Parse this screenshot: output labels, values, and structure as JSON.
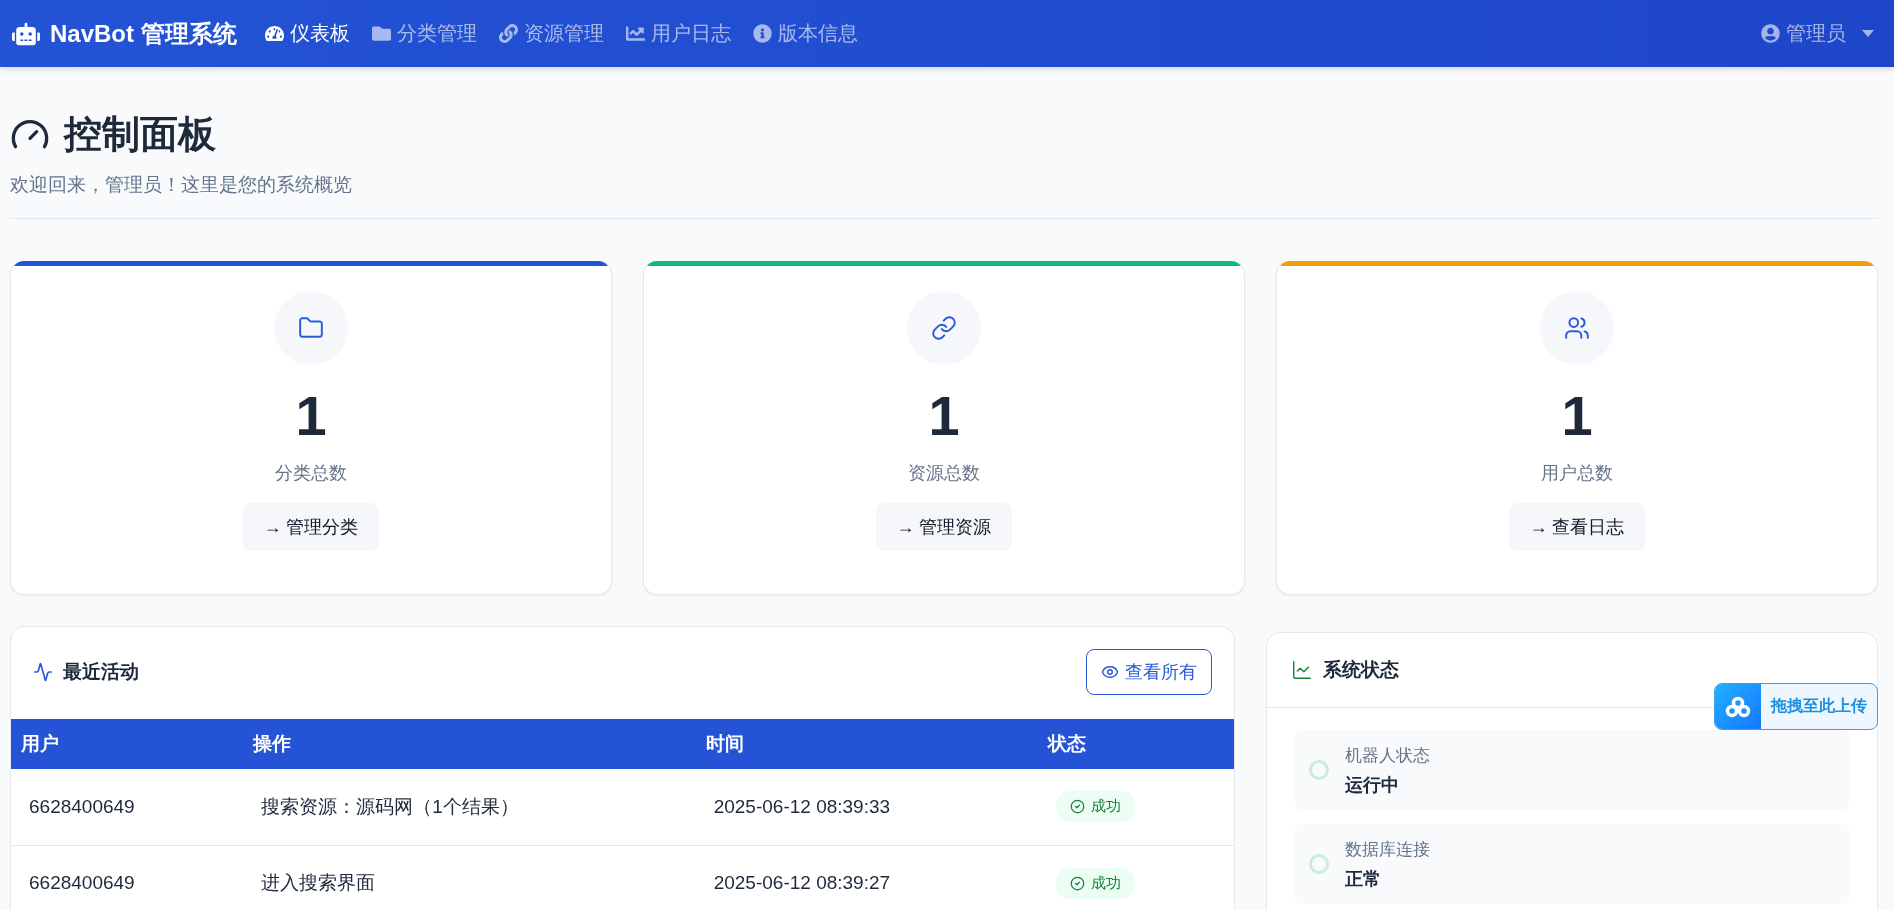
{
  "navbar": {
    "brand": "NavBot 管理系统",
    "items": [
      {
        "label": "仪表板",
        "selected": true
      },
      {
        "label": "分类管理",
        "selected": false
      },
      {
        "label": "资源管理",
        "selected": false
      },
      {
        "label": "用户日志",
        "selected": false
      },
      {
        "label": "版本信息",
        "selected": false
      }
    ],
    "user": "管理员"
  },
  "header": {
    "title": "控制面板",
    "subtitle": "欢迎回来，管理员！这里是您的系统概览"
  },
  "stats": [
    {
      "value": "1",
      "label": "分类总数",
      "action": "→ 管理分类",
      "color": "#2453d6"
    },
    {
      "value": "1",
      "label": "资源总数",
      "action": "→ 管理资源",
      "color": "#10b981"
    },
    {
      "value": "1",
      "label": "用户总数",
      "action": "→ 查看日志",
      "color": "#f59e0b"
    }
  ],
  "recent_activity": {
    "title": "最近活动",
    "view_all": "查看所有",
    "columns": [
      "用户",
      "操作",
      "时间",
      "状态"
    ],
    "rows": [
      {
        "user": "6628400649",
        "action": "搜索资源：源码网（1个结果）",
        "time": "2025-06-12 08:39:33",
        "status": {
          "kind": "success",
          "label": "成功"
        }
      },
      {
        "user": "6628400649",
        "action": "进入搜索界面",
        "time": "2025-06-12 08:39:27",
        "status": {
          "kind": "success",
          "label": "成功"
        }
      }
    ]
  },
  "system_status": {
    "title": "系统状态",
    "items": [
      {
        "label": "机器人状态",
        "value": "运行中"
      },
      {
        "label": "数据库连接",
        "value": "正常"
      }
    ]
  },
  "upload_widget": {
    "label": "拖拽至此上传"
  }
}
